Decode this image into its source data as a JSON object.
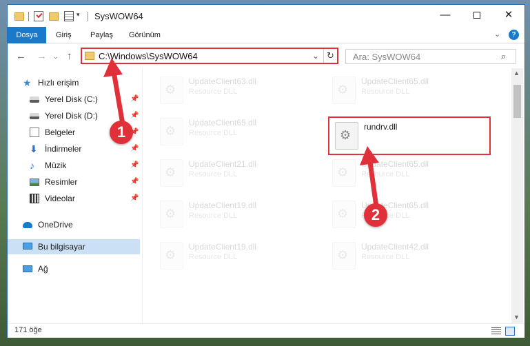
{
  "window": {
    "title": "SysWOW64",
    "controls": {
      "minimize": "—",
      "maximize": "",
      "close": "✕"
    },
    "quick_access_dropdown": "▾"
  },
  "ribbon": {
    "tabs": [
      "Dosya",
      "Giriş",
      "Paylaş",
      "Görünüm"
    ],
    "collapse": "⌄",
    "help": "?"
  },
  "nav": {
    "back": "←",
    "forward": "→",
    "recent": "⌄",
    "up": "↑",
    "address": "C:\\Windows\\SysWOW64",
    "address_dropdown": "⌄",
    "refresh": "↻",
    "search_placeholder": "Ara: SysWOW64",
    "search_icon": "⌕"
  },
  "sidebar": {
    "items": [
      {
        "label": "Hızlı erişim",
        "icon": "star-icon",
        "pinned": false
      },
      {
        "label": "Yerel Disk (C:)",
        "icon": "disk-icon",
        "pinned": true
      },
      {
        "label": "Yerel Disk (D:)",
        "icon": "disk-icon",
        "pinned": true
      },
      {
        "label": "Belgeler",
        "icon": "document-icon",
        "pinned": true
      },
      {
        "label": "İndirmeler",
        "icon": "download-icon",
        "pinned": true
      },
      {
        "label": "Müzik",
        "icon": "music-icon",
        "pinned": true
      },
      {
        "label": "Resimler",
        "icon": "pictures-icon",
        "pinned": true
      },
      {
        "label": "Videolar",
        "icon": "video-icon",
        "pinned": true
      },
      {
        "label": "OneDrive",
        "icon": "onedrive-icon",
        "pinned": false
      },
      {
        "label": "Bu bilgisayar",
        "icon": "computer-icon",
        "pinned": false,
        "selected": true
      },
      {
        "label": "Ağ",
        "icon": "network-icon",
        "pinned": false
      }
    ],
    "pin_glyph": "📌"
  },
  "files": [
    {
      "name": "UpdateClient63.dll",
      "type": "Resource DLL",
      "faded": true
    },
    {
      "name": "UpdateClient65.dll",
      "type": "Resource DLL",
      "faded": true
    },
    {
      "name": "UpdateClient65.dll",
      "type": "Resource DLL",
      "faded": true
    },
    {
      "name": "rundrv.dll",
      "type": "",
      "faded": false,
      "highlighted": true
    },
    {
      "name": "UpdateClient21.dll",
      "type": "Resource DLL",
      "faded": true
    },
    {
      "name": "UpdateClient65.dll",
      "type": "Resource DLL",
      "faded": true
    },
    {
      "name": "UpdateClient19.dll",
      "type": "Resource DLL",
      "faded": true
    },
    {
      "name": "UpdateClient65.dll",
      "type": "Resource DLL",
      "faded": true
    },
    {
      "name": "UpdateClient19.dll",
      "type": "Resource DLL",
      "faded": true
    },
    {
      "name": "UpdateClient42.dll",
      "type": "Resource DLL",
      "faded": true
    }
  ],
  "scrollbar": {
    "up": "▲",
    "down": "▼"
  },
  "status": {
    "count": "171 öğe"
  },
  "annotations": {
    "marker1": "1",
    "marker2": "2",
    "color": "#e0303a"
  }
}
